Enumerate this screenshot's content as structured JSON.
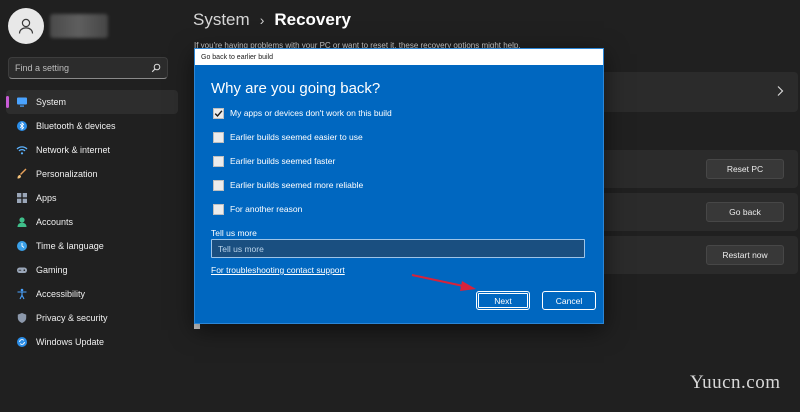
{
  "sidebar": {
    "search_placeholder": "Find a setting",
    "items": [
      {
        "label": "System",
        "icon": "monitor-icon",
        "active": true
      },
      {
        "label": "Bluetooth & devices",
        "icon": "bluetooth-icon"
      },
      {
        "label": "Network & internet",
        "icon": "wifi-icon"
      },
      {
        "label": "Personalization",
        "icon": "brush-icon"
      },
      {
        "label": "Apps",
        "icon": "apps-icon"
      },
      {
        "label": "Accounts",
        "icon": "person-icon"
      },
      {
        "label": "Time & language",
        "icon": "globe-clock-icon"
      },
      {
        "label": "Gaming",
        "icon": "gamepad-icon"
      },
      {
        "label": "Accessibility",
        "icon": "accessibility-icon"
      },
      {
        "label": "Privacy & security",
        "icon": "shield-icon"
      },
      {
        "label": "Windows Update",
        "icon": "update-icon"
      }
    ]
  },
  "header": {
    "crumb_parent": "System",
    "separator": "›",
    "crumb_current": "Recovery"
  },
  "main": {
    "intro": "If you're having problems with your PC or want to reset it, these recovery options might help.",
    "buttons": {
      "reset": "Reset PC",
      "go_back": "Go back",
      "restart": "Restart now"
    }
  },
  "dialog": {
    "title": "Go back to earlier build",
    "heading": "Why are you going back?",
    "options": [
      {
        "label": "My apps or devices don't work on this build",
        "checked": true
      },
      {
        "label": "Earlier builds seemed easier to use",
        "checked": false
      },
      {
        "label": "Earlier builds seemed faster",
        "checked": false
      },
      {
        "label": "Earlier builds seemed more reliable",
        "checked": false
      },
      {
        "label": "For another reason",
        "checked": false
      }
    ],
    "tell_label": "Tell us more",
    "tell_placeholder": "Tell us more",
    "support_link": "For troubleshooting contact support",
    "next": "Next",
    "cancel": "Cancel"
  },
  "watermark": "Yuucn.com",
  "colors": {
    "background": "#202020",
    "dialog": "#0067c0",
    "accent": "#c85bd6",
    "annotation_arrow": "#d6233b"
  }
}
